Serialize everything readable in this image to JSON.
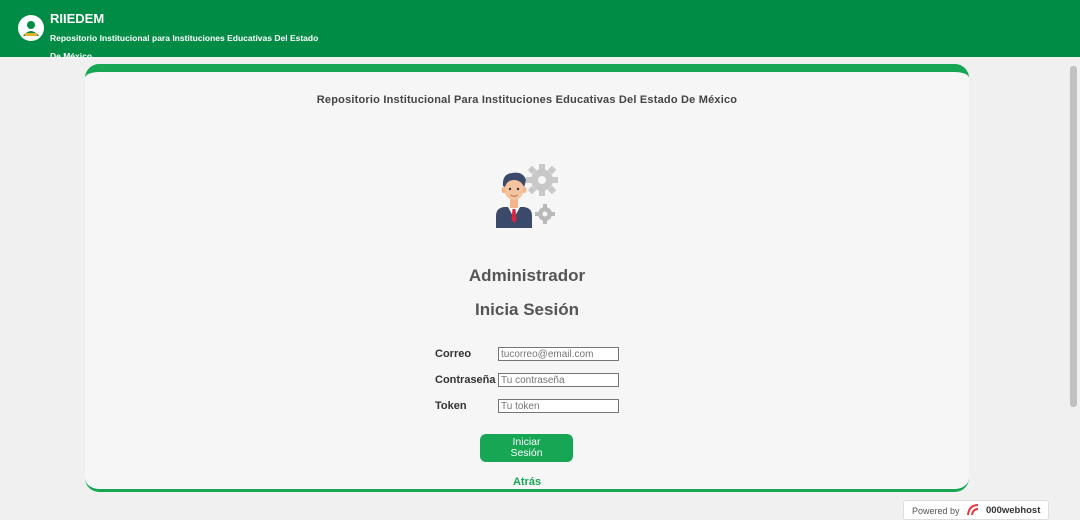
{
  "header": {
    "brand": "RIIEDEM",
    "subtitle": "Repositorio Institucional para Instituciones Educativas Del Estado De México"
  },
  "card": {
    "title": "Repositorio Institucional Para Instituciones Educativas Del Estado De México",
    "heading_admin": "Administrador",
    "heading_login": "Inicia Sesión"
  },
  "form": {
    "email_label": "Correo",
    "email_placeholder": "tucorreo@email.com",
    "password_label": "Contraseña",
    "password_placeholder": "Tu contraseña",
    "token_label": "Token",
    "token_placeholder": "Tu token",
    "submit_label": "Iniciar Sesión",
    "back_label": "Atrás"
  },
  "footer": {
    "powered_by": "Powered by",
    "host_brand": "000webhost"
  },
  "colors": {
    "header_green": "#008c45",
    "accent_green": "#17a654"
  },
  "icons": {
    "logo": "user-book-icon",
    "admin": "admin-gear-avatar-icon"
  }
}
